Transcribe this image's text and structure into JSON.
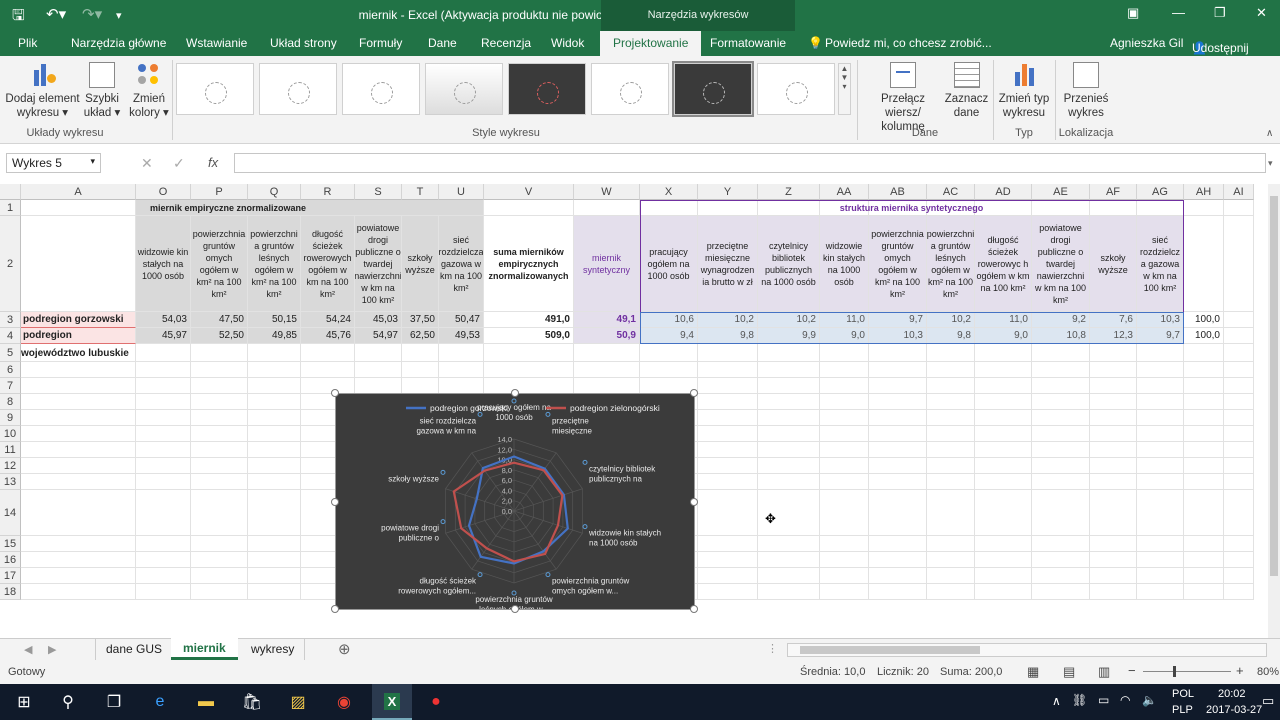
{
  "window": {
    "title": "miernik - Excel (Aktywacja produktu nie powiodła się)",
    "context_tab": "Narzędzia wykresów"
  },
  "tabs": [
    "Plik",
    "Narzędzia główne",
    "Wstawianie",
    "Układ strony",
    "Formuły",
    "Dane",
    "Recenzja",
    "Widok",
    "Projektowanie",
    "Formatowanie"
  ],
  "tell_me": "Powiedz mi, co chcesz zrobić...",
  "user": "Agnieszka Gil",
  "share": "Udostępnij",
  "ribbon": {
    "add_element": "Dodaj element wykresu",
    "quick_layout": "Szybki układ",
    "change_colors": "Zmień kolory",
    "group_layouts": "Układy wykresu",
    "group_styles": "Style wykresu",
    "switch_row_col": "Przełącz wiersz/ kolumnę",
    "select_data": "Zaznacz dane",
    "group_data": "Dane",
    "change_type": "Zmień typ wykresu",
    "group_type": "Typ",
    "move_chart": "Przenieś wykres",
    "group_location": "Lokalizacja"
  },
  "namebox": "Wykres 5",
  "formula_fx": "fx",
  "columns": [
    "A",
    "O",
    "P",
    "Q",
    "R",
    "S",
    "T",
    "U",
    "V",
    "W",
    "X",
    "Y",
    "Z",
    "AA",
    "AB",
    "AC",
    "AD",
    "AE",
    "AF",
    "AG",
    "AH",
    "AI"
  ],
  "rows": [
    "1",
    "2",
    "3",
    "4",
    "5",
    "6",
    "7",
    "8",
    "9",
    "10",
    "11",
    "12",
    "13",
    "14",
    "15",
    "16",
    "17",
    "18"
  ],
  "sheet": {
    "header1_left": "miernik empiryczne znormalizowane",
    "header1_right": "struktura miernika syntetycznego",
    "headers_left": [
      "widzowie kin stałych na 1000 osób",
      "powierzchnia gruntów omych ogółem w km² na 100 km²",
      "powierzchni a gruntów leśnych ogółem w km² na 100 km²",
      "długość ścieżek rowerowych ogółem w km na 100 km²",
      "powiatowe drogi publiczne o twardej nawierzchni w km na 100 km²",
      "szkoły wyższe",
      "sieć rozdzielcza gazowa w km na 100 km²"
    ],
    "header_sum": "suma mierników empirycznych znormalizowanych",
    "header_synth": "miernik syntetyczny",
    "headers_right": [
      "pracujący ogółem na 1000 osób",
      "przeciętne miesięczne wynagrodzen ia brutto w zł",
      "czytelnicy bibliotek publicznych na 1000 osób",
      "widzowie kin stałych na 1000 osób",
      "powierzchnia gruntów omych ogółem w km² na 100 km²",
      "powierzchni a gruntów leśnych ogółem w km² na 100 km²",
      "długość ścieżek rowerowyc h ogółem w km na 100 km²",
      "powiatowe drogi publiczne o twardej nawierzchni w km na 100 km²",
      "szkoły wyższe",
      "sieć rozdzielcz a gazowa w km na 100 km²"
    ],
    "row3": {
      "label": "podregion gorzowski",
      "left": [
        "54,03",
        "47,50",
        "50,15",
        "54,24",
        "45,03",
        "37,50",
        "50,47"
      ],
      "sum": "491,0",
      "synth": "49,1",
      "right": [
        "10,6",
        "10,2",
        "10,2",
        "11,0",
        "9,7",
        "10,2",
        "11,0",
        "9,2",
        "7,6",
        "10,3"
      ],
      "total": "100,0"
    },
    "row4": {
      "label": "podregion zielonogórski",
      "left": [
        "45,97",
        "52,50",
        "49,85",
        "45,76",
        "54,97",
        "62,50",
        "49,53"
      ],
      "sum": "509,0",
      "synth": "50,9",
      "right": [
        "9,4",
        "9,8",
        "9,9",
        "9,0",
        "10,3",
        "9,8",
        "9,0",
        "10,8",
        "12,3",
        "9,7"
      ],
      "total": "100,0"
    },
    "row5_label": "województwo lubuskie"
  },
  "chart_data": {
    "type": "radar",
    "legend": [
      "podregion gorzowski",
      "podregion zielonogórski"
    ],
    "legend_position": "top",
    "categories": [
      "pracujący ogółem na 1000 osób",
      "przeciętne miesięczne wynagrodzenia...",
      "czytelnicy bibliotek publicznych na 1000...",
      "widzowie kin stałych na 1000 osób",
      "powierzchnia gruntów omych ogółem w...",
      "powierzchnia gruntów leśnych ogółem w...",
      "długość ścieżek rowerowych ogółem...",
      "powiatowe drogi publiczne o twardej...",
      "szkoły wyższe",
      "sieć rozdzielcza gazowa w km na 100..."
    ],
    "ticks": [
      "0,0",
      "2,0",
      "4,0",
      "6,0",
      "8,0",
      "10,0",
      "12,0",
      "14,0"
    ],
    "rmax": 14,
    "series": [
      {
        "name": "podregion gorzowski",
        "color": "#4472c4",
        "values": [
          10.6,
          10.2,
          10.2,
          11.0,
          9.7,
          10.2,
          11.0,
          9.2,
          7.6,
          10.3
        ]
      },
      {
        "name": "podregion zielonogórski",
        "color": "#c0504d",
        "values": [
          9.4,
          9.8,
          9.9,
          9.0,
          10.3,
          9.8,
          9.0,
          10.8,
          12.3,
          9.7
        ]
      }
    ]
  },
  "sheet_tabs": [
    "dane GUS",
    "miernik",
    "wykresy"
  ],
  "status": {
    "ready": "Gotowy",
    "avg": "Średnia: 10,0",
    "count": "Licznik: 20",
    "sum": "Suma: 200,0",
    "zoom": "80%"
  },
  "taskbar": {
    "lang1": "POL",
    "lang2": "PLP",
    "time": "20:02",
    "date": "2017-03-27"
  }
}
